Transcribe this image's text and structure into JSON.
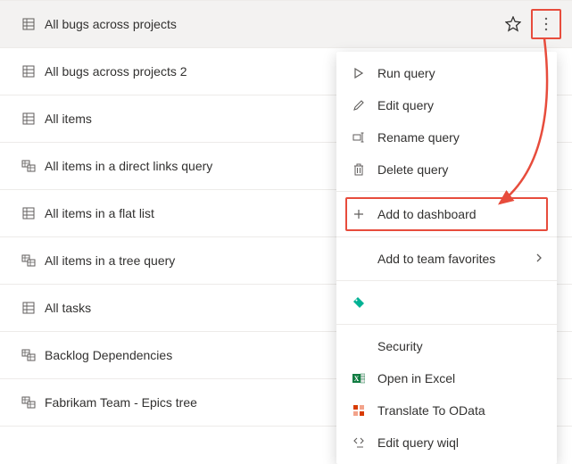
{
  "queries": [
    {
      "label": "All bugs across projects",
      "icon": "flat",
      "selected": true,
      "showActions": true
    },
    {
      "label": "All bugs across projects 2",
      "icon": "flat"
    },
    {
      "label": "All items",
      "icon": "flat"
    },
    {
      "label": "All items in a direct links query",
      "icon": "links"
    },
    {
      "label": "All items in a flat list",
      "icon": "flat"
    },
    {
      "label": "All items in a tree query",
      "icon": "tree"
    },
    {
      "label": "All tasks",
      "icon": "flat"
    },
    {
      "label": "Backlog Dependencies",
      "icon": "links"
    },
    {
      "label": "Fabrikam Team - Epics tree",
      "icon": "tree"
    }
  ],
  "menu": {
    "run": "Run query",
    "edit": "Edit query",
    "rename": "Rename query",
    "delete": "Delete query",
    "addDashboard": "Add to dashboard",
    "addTeamFav": "Add to team favorites",
    "security": "Security",
    "openExcel": "Open in Excel",
    "translateOData": "Translate To OData",
    "editWiql": "Edit query wiql"
  }
}
